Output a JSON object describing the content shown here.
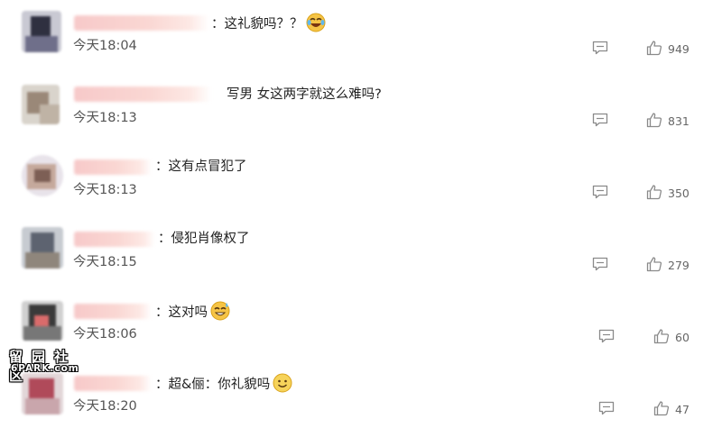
{
  "comments": [
    {
      "text": "：这礼貌吗？？",
      "emoji": "laugh-cry-emoji",
      "time": "今天18:04",
      "likes": "949"
    },
    {
      "text": "写男 女这两字就这么难吗?",
      "emoji": "",
      "time": "今天18:13",
      "likes": "831"
    },
    {
      "text": "：这有点冒犯了",
      "emoji": "",
      "time": "今天18:13",
      "likes": "350"
    },
    {
      "text": "：侵犯肖像权了",
      "emoji": "",
      "time": "今天18:15",
      "likes": "279"
    },
    {
      "text": "：这对吗",
      "emoji": "sweat-smile-emoji",
      "time": "今天18:06",
      "likes": "60"
    },
    {
      "text": "：超&俪：你礼貌吗",
      "emoji": "smile-emoji",
      "time": "今天18:20",
      "likes": "47"
    }
  ],
  "watermark": {
    "cn": "留园社区",
    "en": "6PARK.com"
  },
  "colors": {
    "text": "#222222",
    "time": "#555555",
    "icon": "#8a8a8a",
    "name_blur": "#f7c9c9"
  }
}
